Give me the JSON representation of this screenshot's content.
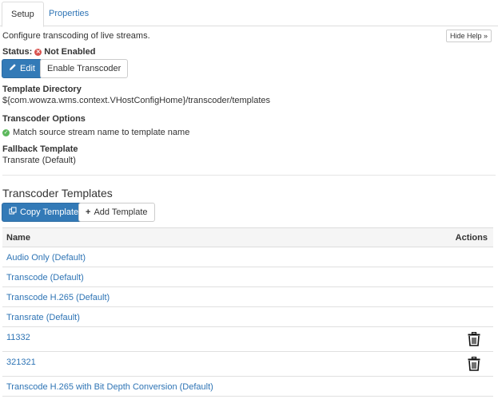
{
  "tabs": [
    {
      "label": "Setup"
    },
    {
      "label": "Properties"
    }
  ],
  "description": "Configure transcoding of live streams.",
  "hide_help": "Hide Help »",
  "status": {
    "label": "Status:",
    "value": "Not Enabled",
    "color": "#d9534f"
  },
  "buttons": {
    "edit": "Edit",
    "enable": "Enable Transcoder",
    "copy": "Copy Template",
    "add": "Add Template"
  },
  "template_directory": {
    "label": "Template Directory",
    "value": "${com.wowza.wms.context.VHostConfigHome}/transcoder/templates"
  },
  "transcoder_options": {
    "label": "Transcoder Options",
    "value": "Match source stream name to template name"
  },
  "fallback": {
    "label": "Fallback Template",
    "value": "Transrate (Default)"
  },
  "section_title": "Transcoder Templates",
  "table": {
    "headers": {
      "name": "Name",
      "actions": "Actions"
    },
    "rows": [
      {
        "name": "Audio Only (Default)",
        "deletable": false
      },
      {
        "name": "Transcode (Default)",
        "deletable": false
      },
      {
        "name": "Transcode H.265 (Default)",
        "deletable": false
      },
      {
        "name": "Transrate (Default)",
        "deletable": false
      },
      {
        "name": "11332",
        "deletable": true
      },
      {
        "name": "321321",
        "deletable": true
      },
      {
        "name": "Transcode H.265 with Bit Depth Conversion (Default)",
        "deletable": false
      }
    ]
  },
  "colors": {
    "primary": "#337ab7",
    "link": "#2e74b5",
    "success": "#5cb85c",
    "danger": "#d9534f"
  }
}
